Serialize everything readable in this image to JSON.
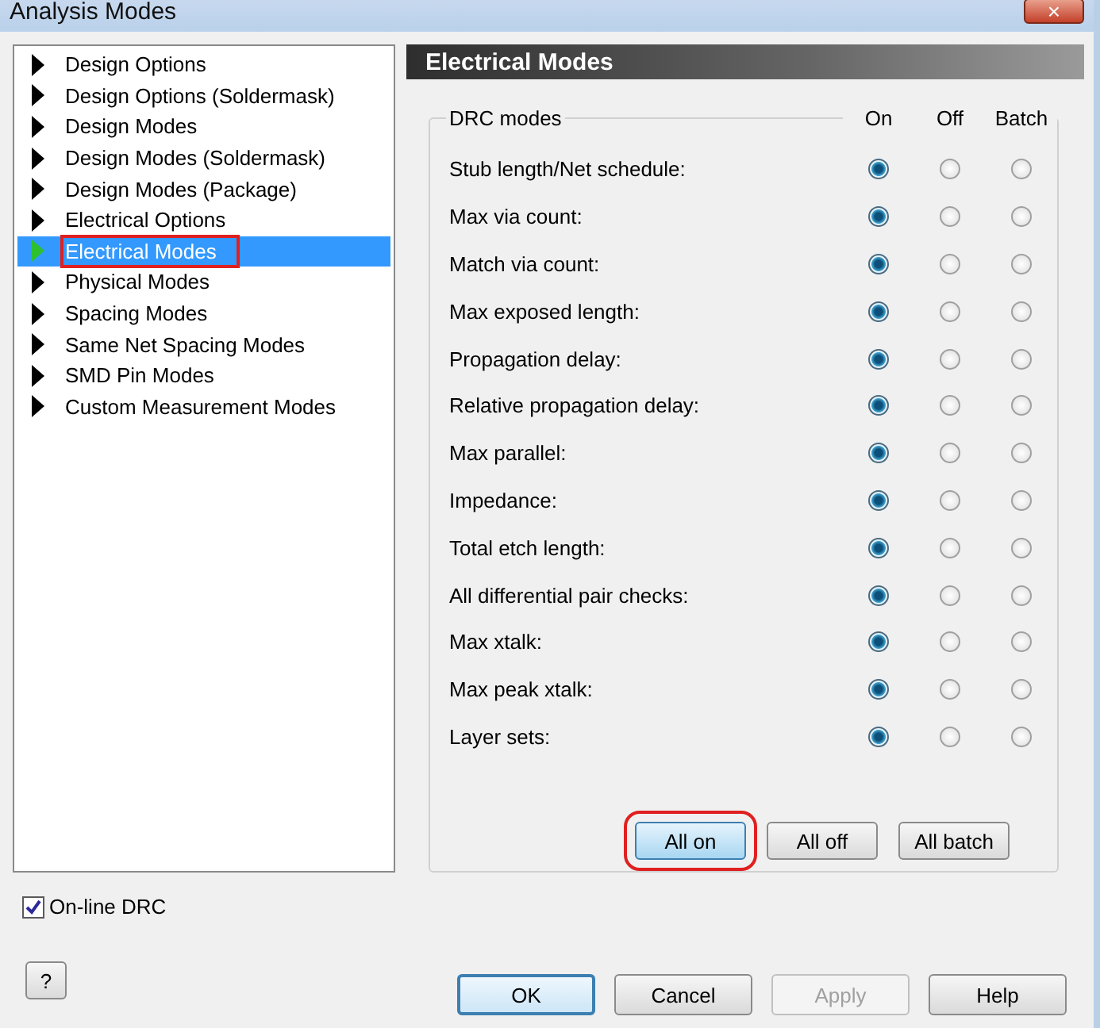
{
  "window": {
    "title": "Analysis Modes",
    "close": "×"
  },
  "sidebar": {
    "items": [
      {
        "label": "Design Options",
        "selected": false,
        "highlighted": false
      },
      {
        "label": "Design Options (Soldermask)",
        "selected": false,
        "highlighted": false
      },
      {
        "label": "Design Modes",
        "selected": false,
        "highlighted": false
      },
      {
        "label": "Design Modes (Soldermask)",
        "selected": false,
        "highlighted": false
      },
      {
        "label": "Design Modes (Package)",
        "selected": false,
        "highlighted": false
      },
      {
        "label": "Electrical Options",
        "selected": false,
        "highlighted": false
      },
      {
        "label": "Electrical Modes",
        "selected": true,
        "highlighted": true
      },
      {
        "label": "Physical Modes",
        "selected": false,
        "highlighted": false
      },
      {
        "label": "Spacing Modes",
        "selected": false,
        "highlighted": false
      },
      {
        "label": "Same Net Spacing Modes",
        "selected": false,
        "highlighted": false
      },
      {
        "label": "SMD Pin Modes",
        "selected": false,
        "highlighted": false
      },
      {
        "label": "Custom Measurement Modes",
        "selected": false,
        "highlighted": false
      }
    ]
  },
  "panel": {
    "title": "Electrical Modes",
    "group": "DRC modes",
    "columns": [
      "On",
      "Off",
      "Batch"
    ],
    "rows": [
      {
        "label": "Stub length/Net schedule:",
        "selected": [
          true,
          false,
          false
        ]
      },
      {
        "label": "Max via count:",
        "selected": [
          true,
          false,
          false
        ]
      },
      {
        "label": "Match via count:",
        "selected": [
          true,
          false,
          false
        ]
      },
      {
        "label": "Max exposed length:",
        "selected": [
          true,
          false,
          false
        ]
      },
      {
        "label": "Propagation delay:",
        "selected": [
          true,
          false,
          false
        ]
      },
      {
        "label": "Relative propagation delay:",
        "selected": [
          true,
          false,
          false
        ]
      },
      {
        "label": "Max parallel:",
        "selected": [
          true,
          false,
          false
        ]
      },
      {
        "label": "Impedance:",
        "selected": [
          true,
          false,
          false
        ]
      },
      {
        "label": "Total etch length:",
        "selected": [
          true,
          false,
          false
        ]
      },
      {
        "label": "All differential pair checks:",
        "selected": [
          true,
          false,
          false
        ]
      },
      {
        "label": "Max xtalk:",
        "selected": [
          true,
          false,
          false
        ]
      },
      {
        "label": "Max peak xtalk:",
        "selected": [
          true,
          false,
          false
        ]
      },
      {
        "label": "Layer sets:",
        "selected": [
          true,
          false,
          false
        ]
      }
    ],
    "buttons": [
      {
        "label": "All on",
        "highlighted": true
      },
      {
        "label": "All off",
        "highlighted": false
      },
      {
        "label": "All batch",
        "highlighted": false
      }
    ]
  },
  "online_drc": {
    "label": "On-line DRC",
    "checked": true
  },
  "help_button": "?",
  "buttons": [
    {
      "label": "OK",
      "default": true,
      "disabled": false
    },
    {
      "label": "Cancel",
      "default": false,
      "disabled": false
    },
    {
      "label": "Apply",
      "default": false,
      "disabled": true
    },
    {
      "label": "Help",
      "default": false,
      "disabled": false
    }
  ]
}
